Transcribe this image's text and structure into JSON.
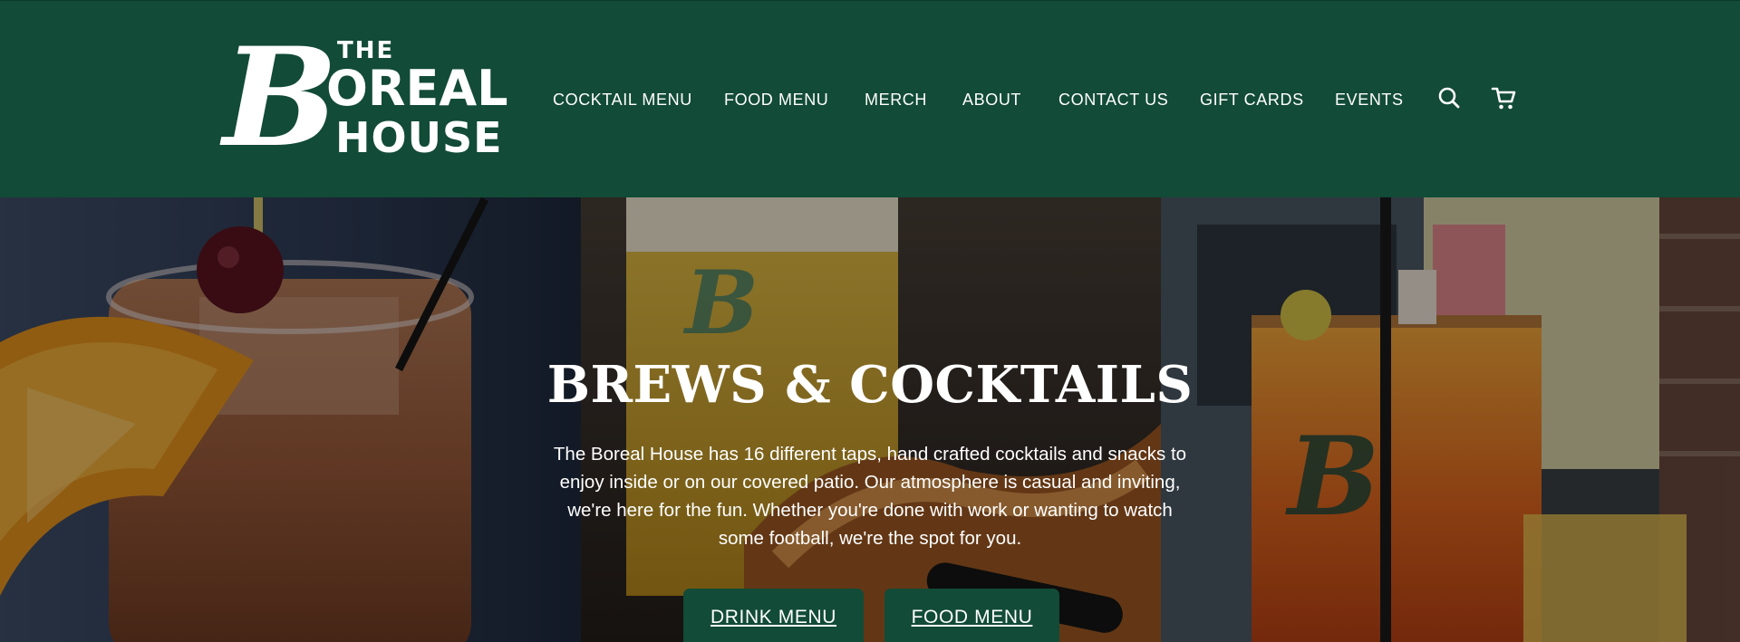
{
  "logo": {
    "the": "THE",
    "b": "B",
    "oreal": "OREAL",
    "house": "HOUSE"
  },
  "nav": {
    "items": [
      {
        "label": "COCKTAIL MENU"
      },
      {
        "label": "FOOD MENU"
      },
      {
        "label": "MERCH"
      },
      {
        "label": "ABOUT"
      },
      {
        "label": "CONTACT US"
      },
      {
        "label": "GIFT CARDS"
      },
      {
        "label": "EVENTS"
      }
    ],
    "icons": [
      "search-icon",
      "cart-icon"
    ]
  },
  "hero": {
    "title": "BREWS & COCKTAILS",
    "text": "The Boreal House has 16 different taps, hand crafted cocktails and snacks to enjoy inside or on our covered patio. Our atmosphere is casual and inviting, we're here for the fun. Whether you're done with work or wanting to watch some football, we're the spot for you.",
    "buttons": [
      {
        "label": "DRINK MENU"
      },
      {
        "label": "FOOD MENU"
      }
    ]
  },
  "colors": {
    "brand_green": "#124b37",
    "text_white": "#ffffff"
  }
}
